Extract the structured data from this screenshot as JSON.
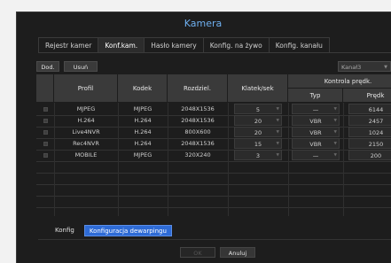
{
  "window": {
    "title": "Kamera"
  },
  "tabs": [
    {
      "label": "Rejestr kamer",
      "active": false
    },
    {
      "label": "Konf.kam.",
      "active": true
    },
    {
      "label": "Hasło kamery",
      "active": false
    },
    {
      "label": "Konfig. na żywo",
      "active": false
    },
    {
      "label": "Konfig. kanału",
      "active": false
    }
  ],
  "toolbar": {
    "add_label": "Dod.",
    "remove_label": "Usuń",
    "channel_value": "Kanał3"
  },
  "table": {
    "headers": {
      "profile": "Profil",
      "codec": "Kodek",
      "resolution": "Rozdziel.",
      "fps": "Klatek/sek",
      "bitrate_group": "Kontrola prędk.",
      "type": "Typ",
      "speed": "Prędk"
    },
    "rows": [
      {
        "profile": "MJPEG",
        "codec": "MJPEG",
        "resolution": "2048X1536",
        "fps": "5",
        "type": "—",
        "speed": "6144"
      },
      {
        "profile": "H.264",
        "codec": "H.264",
        "resolution": "2048X1536",
        "fps": "20",
        "type": "VBR",
        "speed": "2457"
      },
      {
        "profile": "Live4NVR",
        "codec": "H.264",
        "resolution": "800X600",
        "fps": "20",
        "type": "VBR",
        "speed": "1024"
      },
      {
        "profile": "Rec4NVR",
        "codec": "H.264",
        "resolution": "2048X1536",
        "fps": "15",
        "type": "VBR",
        "speed": "2150"
      },
      {
        "profile": "MOBILE",
        "codec": "MJPEG",
        "resolution": "320X240",
        "fps": "3",
        "type": "—",
        "speed": "200"
      }
    ]
  },
  "bottom_tabs": [
    {
      "label": "Konfig",
      "active": false
    },
    {
      "label": "Konfiguracja dewarpingu",
      "active": true
    }
  ],
  "footer": {
    "ok_label": "OK",
    "cancel_label": "Anuluj"
  },
  "colors": {
    "accent": "#2e6bd6",
    "title": "#6fb0f0",
    "background": "#1d1d1d"
  }
}
